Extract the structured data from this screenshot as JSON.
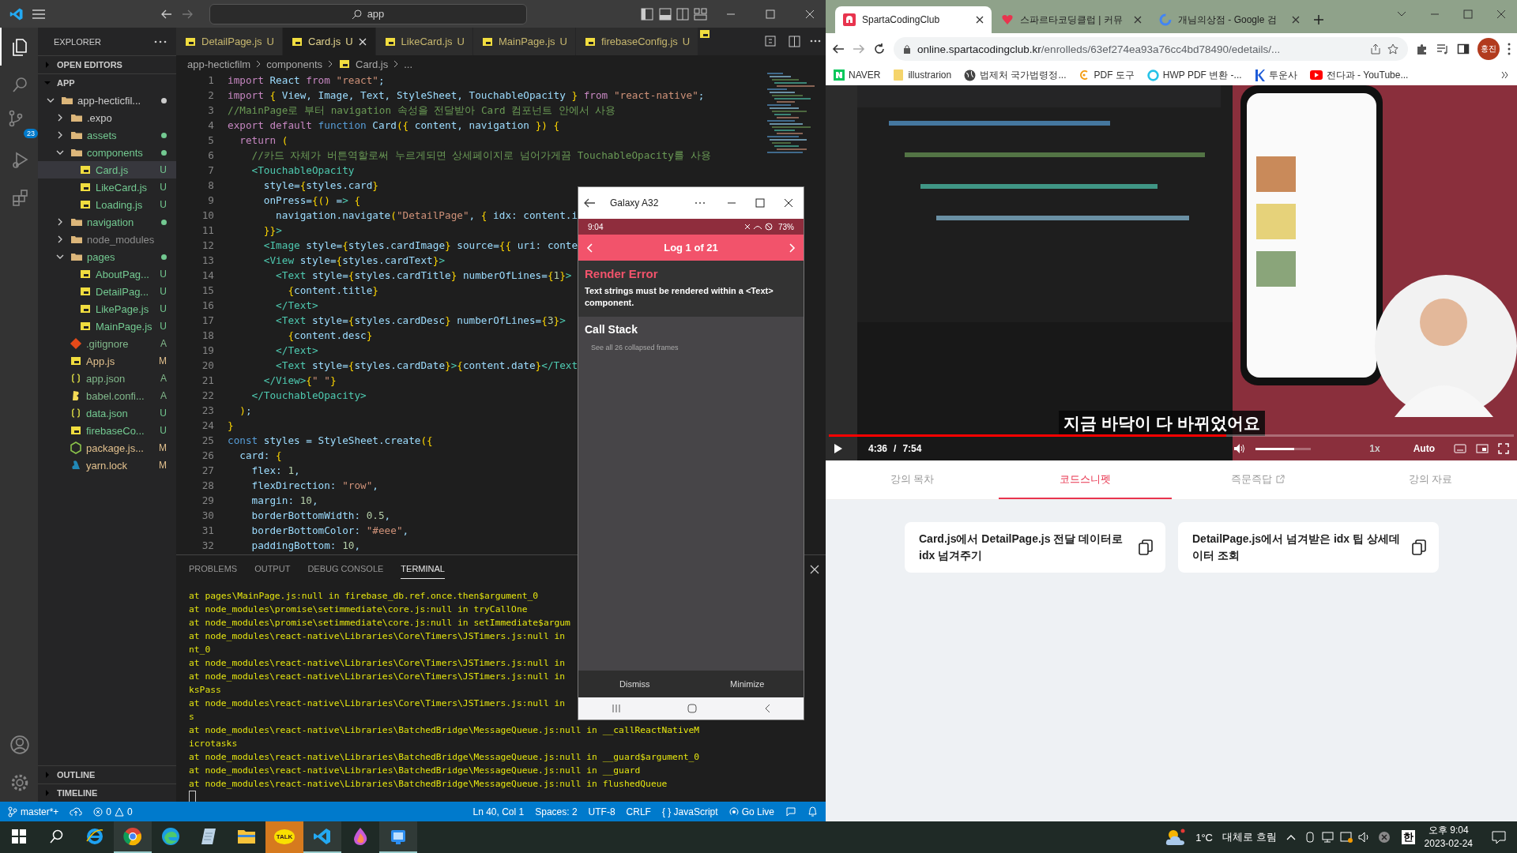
{
  "vscode": {
    "command_center": "app",
    "activity_bar": [
      {
        "kind": "explorer",
        "selected": true
      },
      {
        "kind": "search",
        "selected": false
      },
      {
        "kind": "source-control",
        "selected": false,
        "badge": "23"
      },
      {
        "kind": "run",
        "selected": false
      },
      {
        "kind": "extensions",
        "selected": false
      }
    ],
    "activity_bar_bottom": [
      {
        "kind": "account"
      },
      {
        "kind": "settings"
      }
    ],
    "sidebar": {
      "title": "EXPLORER",
      "open_editors": {
        "label": "OPEN EDITORS",
        "expanded": false
      },
      "root": {
        "label": "APP",
        "expanded": true
      },
      "tree": [
        {
          "name": "app-hecticfil...",
          "kind": "folder",
          "color": "#cccccc",
          "dot": true,
          "expanded": true,
          "children": [
            {
              "name": ".expo",
              "kind": "folder",
              "color": "#cccccc",
              "dot": false,
              "expanded": false
            },
            {
              "name": "assets",
              "kind": "folder",
              "color": "#73c991",
              "dot": true,
              "expanded": false
            },
            {
              "name": "components",
              "kind": "folder",
              "color": "#73c991",
              "dot": true,
              "expanded": true,
              "children": [
                {
                  "name": "Card.js",
                  "kind": "js",
                  "badge": "U",
                  "color": "#73c991",
                  "selected": true
                },
                {
                  "name": "LikeCard.js",
                  "kind": "js",
                  "badge": "U",
                  "color": "#73c991",
                  "selected": false
                },
                {
                  "name": "Loading.js",
                  "kind": "js",
                  "badge": "U",
                  "color": "#73c991",
                  "selected": false
                }
              ]
            },
            {
              "name": "navigation",
              "kind": "folder",
              "color": "#73c991",
              "dot": true,
              "expanded": false
            },
            {
              "name": "node_modules",
              "kind": "folder",
              "color": "#8c8c8c",
              "dot": false,
              "expanded": false
            },
            {
              "name": "pages",
              "kind": "folder",
              "color": "#73c991",
              "dot": true,
              "expanded": true,
              "children": [
                {
                  "name": "AboutPag...",
                  "kind": "js",
                  "badge": "U",
                  "color": "#73c991",
                  "selected": false
                },
                {
                  "name": "DetailPag...",
                  "kind": "js",
                  "badge": "U",
                  "color": "#73c991",
                  "selected": false
                },
                {
                  "name": "LikePage.js",
                  "kind": "js",
                  "badge": "U",
                  "color": "#73c991",
                  "selected": false
                },
                {
                  "name": "MainPage.js",
                  "kind": "js",
                  "badge": "U",
                  "color": "#73c991",
                  "selected": false
                }
              ]
            },
            {
              "name": ".gitignore",
              "kind": "git",
              "badge": "A",
              "color": "#81b88b",
              "selected": false
            },
            {
              "name": "App.js",
              "kind": "js",
              "badge": "M",
              "color": "#e2c08d",
              "selected": false
            },
            {
              "name": "app.json",
              "kind": "json",
              "badge": "A",
              "color": "#81b88b",
              "selected": false
            },
            {
              "name": "babel.confi...",
              "kind": "babel",
              "badge": "A",
              "color": "#81b88b",
              "selected": false
            },
            {
              "name": "data.json",
              "kind": "json",
              "badge": "U",
              "color": "#73c991",
              "selected": false
            },
            {
              "name": "firebaseCo...",
              "kind": "js",
              "badge": "U",
              "color": "#73c991",
              "selected": false
            },
            {
              "name": "package.js...",
              "kind": "node",
              "badge": "M",
              "color": "#e2c08d",
              "selected": false
            },
            {
              "name": "yarn.lock",
              "kind": "yarn",
              "badge": "M",
              "color": "#e2c08d",
              "selected": false
            }
          ]
        }
      ],
      "outline": {
        "label": "OUTLINE",
        "expanded": false
      },
      "timeline": {
        "label": "TIMELINE",
        "expanded": false
      }
    },
    "tabs": [
      {
        "label": "DetailPage.js",
        "badge": "U",
        "selected": false
      },
      {
        "label": "Card.js",
        "badge": "U",
        "selected": true
      },
      {
        "label": "LikeCard.js",
        "badge": "U",
        "selected": false
      },
      {
        "label": "MainPage.js",
        "badge": "U",
        "selected": false
      },
      {
        "label": "firebaseConfig.js",
        "badge": "U",
        "selected": false
      }
    ],
    "breadcrumbs": [
      "app-hecticfilm",
      "components",
      "Card.js",
      "..."
    ],
    "code": [
      {
        "n": "1",
        "text": "import React from \"react\";"
      },
      {
        "n": "2",
        "text": "import { View, Image, Text, StyleSheet, TouchableOpacity } from \"react-native\";"
      },
      {
        "n": "3",
        "text": "//MainPage로 부터 navigation 속성을 전달받아 Card 컴포넌트 안에서 사용"
      },
      {
        "n": "4",
        "text": "export default function Card({ content, navigation }) {"
      },
      {
        "n": "5",
        "text": "  return ("
      },
      {
        "n": "6",
        "text": "    //카드 자체가 버튼역할로써 누르게되면 상세페이지로 넘어가게끔 TouchableOpacity를 사용"
      },
      {
        "n": "7",
        "text": "    <TouchableOpacity"
      },
      {
        "n": "8",
        "text": "      style={styles.card}"
      },
      {
        "n": "9",
        "text": "      onPress={() => {"
      },
      {
        "n": "10",
        "text": "        navigation.navigate(\"DetailPage\", { idx: content.i"
      },
      {
        "n": "11",
        "text": "      }}>"
      },
      {
        "n": "12",
        "text": "      <Image style={styles.cardImage} source={{ uri: conte"
      },
      {
        "n": "13",
        "text": "      <View style={styles.cardText}>"
      },
      {
        "n": "14",
        "text": "        <Text style={styles.cardTitle} numberOfLines={1}>"
      },
      {
        "n": "15",
        "text": "          {content.title}"
      },
      {
        "n": "16",
        "text": "        </Text>"
      },
      {
        "n": "17",
        "text": "        <Text style={styles.cardDesc} numberOfLines={3}>"
      },
      {
        "n": "18",
        "text": "          {content.desc}"
      },
      {
        "n": "19",
        "text": "        </Text>"
      },
      {
        "n": "20",
        "text": "        <Text style={styles.cardDate}>{content.date}</Text"
      },
      {
        "n": "21",
        "text": "      </View>{\" \"}"
      },
      {
        "n": "22",
        "text": "    </TouchableOpacity>"
      },
      {
        "n": "23",
        "text": "  );"
      },
      {
        "n": "24",
        "text": "}"
      },
      {
        "n": "25",
        "text": "const styles = StyleSheet.create({"
      },
      {
        "n": "26",
        "text": "  card: {"
      },
      {
        "n": "27",
        "text": "    flex: 1,"
      },
      {
        "n": "28",
        "text": "    flexDirection: \"row\","
      },
      {
        "n": "29",
        "text": "    margin: 10,"
      },
      {
        "n": "30",
        "text": "    borderBottomWidth: 0.5,"
      },
      {
        "n": "31",
        "text": "    borderBottomColor: \"#eee\","
      },
      {
        "n": "32",
        "text": "    paddingBottom: 10,"
      }
    ],
    "panel": {
      "tabs": [
        {
          "label": "PROBLEMS",
          "selected": false
        },
        {
          "label": "OUTPUT",
          "selected": false
        },
        {
          "label": "DEBUG CONSOLE",
          "selected": false
        },
        {
          "label": "TERMINAL",
          "selected": true
        }
      ],
      "terminal": [
        "at pages\\MainPage.js:null in firebase_db.ref.once.then$argument_0",
        "at node_modules\\promise\\setimmediate\\core.js:null in tryCallOne",
        "at node_modules\\promise\\setimmediate\\core.js:null in setImmediate$argum",
        "at node_modules\\react-native\\Libraries\\Core\\Timers\\JSTimers.js:null in",
        "nt_0",
        "at node_modules\\react-native\\Libraries\\Core\\Timers\\JSTimers.js:null in",
        "at node_modules\\react-native\\Libraries\\Core\\Timers\\JSTimers.js:null in",
        "ksPass",
        "at node_modules\\react-native\\Libraries\\Core\\Timers\\JSTimers.js:null in",
        "s",
        "at node_modules\\react-native\\Libraries\\BatchedBridge\\MessageQueue.js:null in __callReactNativeM",
        "icrotasks",
        "at node_modules\\react-native\\Libraries\\BatchedBridge\\MessageQueue.js:null in __guard$argument_0",
        "at node_modules\\react-native\\Libraries\\BatchedBridge\\MessageQueue.js:null in __guard",
        "at node_modules\\react-native\\Libraries\\BatchedBridge\\MessageQueue.js:null in flushedQueue"
      ]
    },
    "status_bar": {
      "branch": "master*+",
      "errors": "0",
      "warnings": "0",
      "right": [
        "Ln 40, Col 1",
        "Spaces: 2",
        "UTF-8",
        "CRLF",
        "{ } JavaScript"
      ],
      "go_live": "Go Live"
    }
  },
  "emulator": {
    "title": "Galaxy A32",
    "time": "9:04",
    "battery": "73%",
    "header": "Log 1 of 21",
    "error_title": "Render Error",
    "error_message": "Text strings must be rendered within a <Text> component.",
    "call_stack": "Call Stack",
    "collapsed": "See all 26 collapsed frames",
    "buttons": [
      "Dismiss",
      "Minimize"
    ]
  },
  "browser": {
    "tabs": [
      {
        "title": "SpartaCodingClub",
        "kind": "sparta",
        "selected": true
      },
      {
        "title": "스파르타코딩클럽 | 커뮤",
        "kind": "heart",
        "selected": false
      },
      {
        "title": "개님의상점 - Google 검",
        "kind": "google",
        "selected": false
      }
    ],
    "url_host": "online.spartacodingclub.kr",
    "url_path": "/enrolleds/63ef274ea93a76cc4bd78490/edetails/...",
    "profile": "홍진",
    "bookmarks": [
      {
        "label": "NAVER",
        "kind": "naver"
      },
      {
        "label": "illustrarion",
        "kind": "folder"
      },
      {
        "label": "법제처 국가법령정...",
        "kind": "globe"
      },
      {
        "label": "PDF 도구",
        "kind": "pdf"
      },
      {
        "label": "HWP PDF 변환 -...",
        "kind": "ring"
      },
      {
        "label": "투운사",
        "kind": "k"
      },
      {
        "label": "전다과 - YouTube...",
        "kind": "youtube"
      }
    ],
    "video": {
      "subtitle": "지금 바닥이 다 바뀌었어요",
      "current": "4:36",
      "separator": "/",
      "total": "7:54",
      "level": 0.58,
      "volume": {
        "level": 0.7
      },
      "speed": "1x",
      "quality": "Auto"
    },
    "lesson_tabs": [
      {
        "label": "강의 목차",
        "selected": false,
        "external": false
      },
      {
        "label": "코드스니펫",
        "selected": true,
        "external": false
      },
      {
        "label": "즉문즉답",
        "selected": false,
        "external": true
      },
      {
        "label": "강의 자료",
        "selected": false,
        "external": false
      }
    ],
    "snippets": [
      {
        "title": "Card.js에서 DetailPage.js 전달 데이터로 idx 넘겨주기"
      },
      {
        "title": "DetailPage.js에서 넘겨받은 idx 팁 상세데이터 조회"
      }
    ]
  },
  "taskbar": {
    "apps": [
      {
        "kind": "ie",
        "active": false
      },
      {
        "kind": "chrome",
        "active": true
      },
      {
        "kind": "edge",
        "active": false
      },
      {
        "kind": "notes",
        "active": false
      },
      {
        "kind": "files",
        "active": false
      },
      {
        "kind": "kakao",
        "active": true,
        "label": "TALK"
      },
      {
        "kind": "vscode",
        "active": true
      },
      {
        "kind": "drop",
        "active": false
      },
      {
        "kind": "emulator",
        "active": true
      }
    ],
    "temperature": "1°C",
    "weather": "대체로 흐림",
    "ime": "한",
    "time": "오후 9:04",
    "date": "2023-02-24"
  }
}
